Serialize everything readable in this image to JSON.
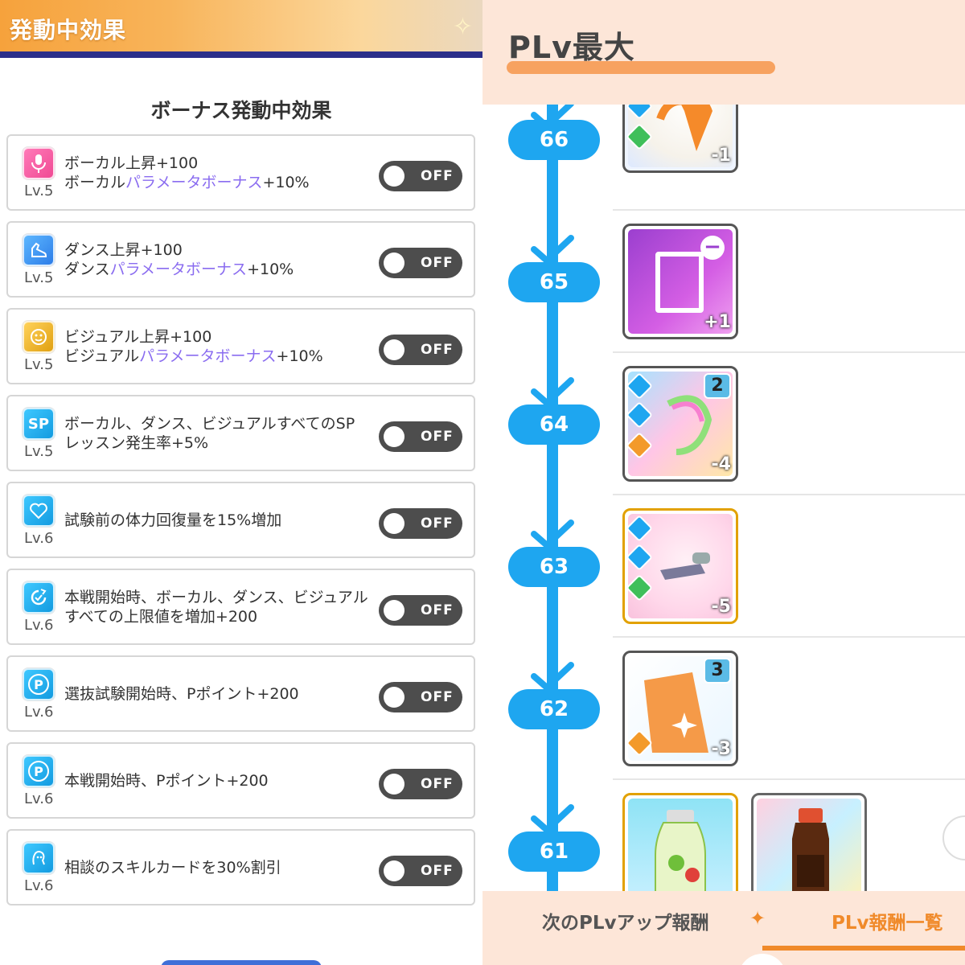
{
  "left": {
    "header_title": "発動中効果",
    "section_title": "ボーナス発動中効果",
    "effects": [
      {
        "icon": "microphone-icon",
        "icon_color": "#f04a94",
        "line1": "ボーカル上昇+100",
        "line2_a": "ボーカル",
        "line2_hl": "パラメータボーナス",
        "line2_b": "+10%",
        "level": "Lv.5",
        "toggle": "OFF"
      },
      {
        "icon": "dance-shoe-icon",
        "icon_color": "#2d7de8",
        "line1": "ダンス上昇+100",
        "line2_a": "ダンス",
        "line2_hl": "パラメータボーナス",
        "line2_b": "+10%",
        "level": "Lv.5",
        "toggle": "OFF"
      },
      {
        "icon": "visual-face-icon",
        "icon_color": "#e0a012",
        "line1": "ビジュアル上昇+100",
        "line2_a": "ビジュアル",
        "line2_hl": "パラメータボーナス",
        "line2_b": "+10%",
        "level": "Lv.5",
        "toggle": "OFF"
      },
      {
        "icon": "sp-icon",
        "icon_label": "SP",
        "icon_color": "#139be0",
        "line1": "ボーカル、ダンス、ビジュアルすべてのSP",
        "line2": "レッスン発生率+5%",
        "level": "Lv.5",
        "toggle": "OFF"
      },
      {
        "icon": "heart-icon",
        "icon_color": "#139be0",
        "text": "試験前の体力回復量を15%増加",
        "level": "Lv.6",
        "toggle": "OFF"
      },
      {
        "icon": "limit-up-icon",
        "icon_color": "#139be0",
        "line1": "本戦開始時、ボーカル、ダンス、ビジュアル",
        "line2": "すべての上限値を増加+200",
        "level": "Lv.6",
        "toggle": "OFF"
      },
      {
        "icon": "p-point-icon",
        "icon_label": "P",
        "icon_color": "#139be0",
        "text": "選抜試験開始時、Pポイント+200",
        "level": "Lv.6",
        "toggle": "OFF"
      },
      {
        "icon": "p-point-icon",
        "icon_label": "P",
        "icon_color": "#139be0",
        "text": "本戦開始時、Pポイント+200",
        "level": "Lv.6",
        "toggle": "OFF"
      },
      {
        "icon": "consult-icon",
        "icon_color": "#139be0",
        "text": "相談のスキルカードを30%割引",
        "level": "Lv.6",
        "toggle": "OFF"
      }
    ]
  },
  "right": {
    "header_title": "PLv最大",
    "levels": [
      {
        "level": "66",
        "cards": [
          {
            "count": "-1",
            "color": "#f5f7ff"
          }
        ]
      },
      {
        "level": "65",
        "cards": [
          {
            "count": "+1",
            "color": "#b24fd6"
          }
        ]
      },
      {
        "level": "64",
        "cards": [
          {
            "count": "-4",
            "number": "2",
            "color": "#ffc6e6"
          }
        ]
      },
      {
        "level": "63",
        "cards": [
          {
            "count": "-5",
            "color": "#ffd7ea"
          }
        ]
      },
      {
        "level": "62",
        "cards": [
          {
            "count": "-3",
            "number": "3",
            "color": "#f59a48"
          }
        ]
      },
      {
        "level": "61",
        "cards": [
          {
            "count": "",
            "color": "#8fe3f5"
          },
          {
            "count": "",
            "color": "#f7d2d8"
          }
        ]
      }
    ],
    "tabs": {
      "next": "次のPLvアップ報酬",
      "list": "PLv報酬一覧"
    },
    "accent_color": "#f08a2a"
  }
}
